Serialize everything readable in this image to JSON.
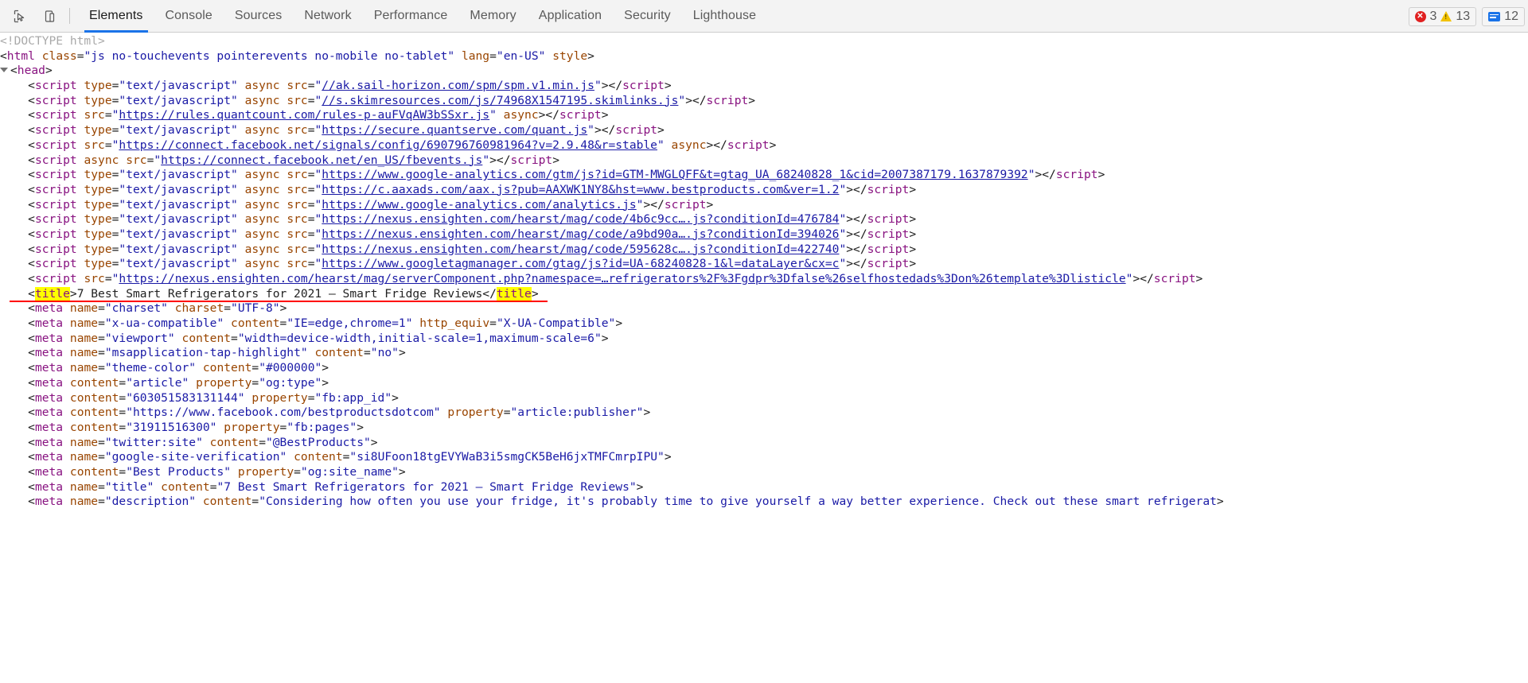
{
  "toolbar": {
    "inspect_icon": "inspect-cursor-icon",
    "device_icon": "device-toolbar-icon",
    "tabs": [
      {
        "label": "Elements",
        "selected": true
      },
      {
        "label": "Console",
        "selected": false
      },
      {
        "label": "Sources",
        "selected": false
      },
      {
        "label": "Network",
        "selected": false
      },
      {
        "label": "Performance",
        "selected": false
      },
      {
        "label": "Memory",
        "selected": false
      },
      {
        "label": "Application",
        "selected": false
      },
      {
        "label": "Security",
        "selected": false
      },
      {
        "label": "Lighthouse",
        "selected": false
      }
    ],
    "error_count": "3",
    "warning_count": "13",
    "message_count": "12",
    "error_icon": "error-circle-icon",
    "warning_icon": "warning-triangle-icon",
    "message_icon": "message-bubble-icon"
  },
  "dom": {
    "doctype": "<!DOCTYPE html>",
    "html_open": {
      "tag": "html",
      "attr_class": "class",
      "val_class": "\"js no-touchevents pointerevents no-mobile no-tablet\"",
      "attr_lang": "lang",
      "val_lang": "\"en-US\"",
      "attr_style": "style"
    },
    "head_tag": "head",
    "lines": [
      {
        "type": "script",
        "attrs": [
          [
            "type",
            "\"text/javascript\""
          ],
          [
            "async",
            ""
          ]
        ],
        "src_label": "src",
        "link": "//ak.sail-horizon.com/spm/spm.v1.min.js",
        "trailing": ""
      },
      {
        "type": "script",
        "attrs": [
          [
            "type",
            "\"text/javascript\""
          ],
          [
            "async",
            ""
          ]
        ],
        "src_label": "src",
        "link": "//s.skimresources.com/js/74968X1547195.skimlinks.js",
        "trailing": ""
      },
      {
        "type": "script",
        "attrs": [],
        "src_label": "src",
        "link": "https://rules.quantcount.com/rules-p-auFVqAW3bSSxr.js",
        "trailing": " async"
      },
      {
        "type": "script",
        "attrs": [
          [
            "type",
            "\"text/javascript\""
          ],
          [
            "async",
            ""
          ]
        ],
        "src_label": "src",
        "link": "https://secure.quantserve.com/quant.js",
        "trailing": ""
      },
      {
        "type": "script",
        "attrs": [],
        "src_label": "src",
        "link": "https://connect.facebook.net/signals/config/690796760981964?v=2.9.48&r=stable",
        "trailing": " async"
      },
      {
        "type": "script",
        "attrs": [
          [
            "async",
            ""
          ]
        ],
        "src_label": "src",
        "link": "https://connect.facebook.net/en_US/fbevents.js",
        "trailing": ""
      },
      {
        "type": "script",
        "attrs": [
          [
            "type",
            "\"text/javascript\""
          ],
          [
            "async",
            ""
          ]
        ],
        "src_label": "src",
        "link": "https://www.google-analytics.com/gtm/js?id=GTM-MWGLQFF&t=gtag_UA_68240828_1&cid=2007387179.1637879392",
        "trailing": ""
      },
      {
        "type": "script",
        "attrs": [
          [
            "type",
            "\"text/javascript\""
          ],
          [
            "async",
            ""
          ]
        ],
        "src_label": "src",
        "link": "https://c.aaxads.com/aax.js?pub=AAXWK1NY8&hst=www.bestproducts.com&ver=1.2",
        "trailing": ""
      },
      {
        "type": "script",
        "attrs": [
          [
            "type",
            "\"text/javascript\""
          ],
          [
            "async",
            ""
          ]
        ],
        "src_label": "src",
        "link": "https://www.google-analytics.com/analytics.js",
        "trailing": ""
      },
      {
        "type": "script",
        "attrs": [
          [
            "type",
            "\"text/javascript\""
          ],
          [
            "async",
            ""
          ]
        ],
        "src_label": "src",
        "link": "https://nexus.ensighten.com/hearst/mag/code/4b6c9cc….js?conditionId=476784",
        "trailing": ""
      },
      {
        "type": "script",
        "attrs": [
          [
            "type",
            "\"text/javascript\""
          ],
          [
            "async",
            ""
          ]
        ],
        "src_label": "src",
        "link": "https://nexus.ensighten.com/hearst/mag/code/a9bd90a….js?conditionId=394026",
        "trailing": ""
      },
      {
        "type": "script",
        "attrs": [
          [
            "type",
            "\"text/javascript\""
          ],
          [
            "async",
            ""
          ]
        ],
        "src_label": "src",
        "link": "https://nexus.ensighten.com/hearst/mag/code/595628c….js?conditionId=422740",
        "trailing": ""
      },
      {
        "type": "script",
        "attrs": [
          [
            "type",
            "\"text/javascript\""
          ],
          [
            "async",
            ""
          ]
        ],
        "src_label": "src",
        "link": "https://www.googletagmanager.com/gtag/js?id=UA-68240828-1&l=dataLayer&cx=c",
        "trailing": ""
      },
      {
        "type": "script",
        "attrs": [],
        "src_label": "src",
        "link": "https://nexus.ensighten.com/hearst/mag/serverComponent.php?namespace=…refrigerators%2F%3Fgdpr%3Dfalse%26selfhostedads%3Don%26template%3Dlisticle",
        "trailing": ""
      }
    ],
    "title_line": {
      "open_lt": "<",
      "open_tag": "title",
      "open_gt": ">",
      "text": "7 Best Smart Refrigerators for 2021 – Smart Fridge Reviews",
      "close_lt": "</",
      "close_tag": "title",
      "close_gt": ">"
    },
    "metas": [
      {
        "attrs": [
          [
            "name",
            "\"charset\""
          ],
          [
            "charset",
            "\"UTF-8\""
          ]
        ]
      },
      {
        "attrs": [
          [
            "name",
            "\"x-ua-compatible\""
          ],
          [
            "content",
            "\"IE=edge,chrome=1\""
          ],
          [
            "http_equiv",
            "\"X-UA-Compatible\""
          ]
        ]
      },
      {
        "attrs": [
          [
            "name",
            "\"viewport\""
          ],
          [
            "content",
            "\"width=device-width,initial-scale=1,maximum-scale=6\""
          ]
        ]
      },
      {
        "attrs": [
          [
            "name",
            "\"msapplication-tap-highlight\""
          ],
          [
            "content",
            "\"no\""
          ]
        ]
      },
      {
        "attrs": [
          [
            "name",
            "\"theme-color\""
          ],
          [
            "content",
            "\"#000000\""
          ]
        ]
      },
      {
        "attrs": [
          [
            "content",
            "\"article\""
          ],
          [
            "property",
            "\"og:type\""
          ]
        ]
      },
      {
        "attrs": [
          [
            "content",
            "\"603051583131144\""
          ],
          [
            "property",
            "\"fb:app_id\""
          ]
        ]
      },
      {
        "attrs": [
          [
            "content",
            "\"https://www.facebook.com/bestproductsdotcom\""
          ],
          [
            "property",
            "\"article:publisher\""
          ]
        ]
      },
      {
        "attrs": [
          [
            "content",
            "\"31911516300\""
          ],
          [
            "property",
            "\"fb:pages\""
          ]
        ]
      },
      {
        "attrs": [
          [
            "name",
            "\"twitter:site\""
          ],
          [
            "content",
            "\"@BestProducts\""
          ]
        ]
      },
      {
        "attrs": [
          [
            "name",
            "\"google-site-verification\""
          ],
          [
            "content",
            "\"si8UFoon18tgEVYWaB3i5smgCK5BeH6jxTMFCmrpIPU\""
          ]
        ]
      },
      {
        "attrs": [
          [
            "content",
            "\"Best Products\""
          ],
          [
            "property",
            "\"og:site_name\""
          ]
        ]
      },
      {
        "attrs": [
          [
            "name",
            "\"title\""
          ],
          [
            "content",
            "\"7 Best Smart Refrigerators for 2021 – Smart Fridge Reviews\""
          ]
        ]
      },
      {
        "attrs": [
          [
            "name",
            "\"description\""
          ],
          [
            "content",
            "\"Considering how often you use your fridge, it's probably time to give yourself a way better experience. Check out these smart refrigerat"
          ]
        ]
      }
    ]
  }
}
